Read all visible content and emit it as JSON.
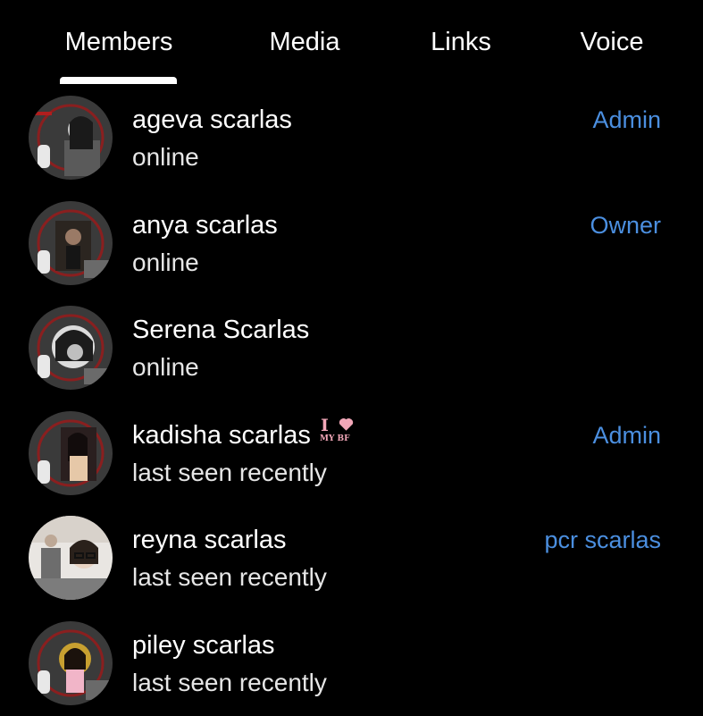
{
  "tabs": [
    {
      "label": "Members",
      "active": true
    },
    {
      "label": "Media"
    },
    {
      "label": "Links"
    },
    {
      "label": "Voice"
    }
  ],
  "colors": {
    "background": "#000000",
    "text": "#ffffff",
    "role_accent": "#4b8fe0"
  },
  "members": [
    {
      "name": "ageva scarlas",
      "status": "online",
      "role": "Admin"
    },
    {
      "name": "anya scarlas",
      "status": "online",
      "role": "Owner"
    },
    {
      "name": "Serena Scarlas",
      "status": "online",
      "role": ""
    },
    {
      "name": "kadisha scarlas",
      "status": "last seen recently",
      "role": "Admin",
      "sticker_text": "MY BF"
    },
    {
      "name": "reyna scarlas",
      "status": "last seen recently",
      "role": "pcr scarlas"
    },
    {
      "name": "piley scarlas",
      "status": "last seen recently",
      "role": ""
    }
  ]
}
